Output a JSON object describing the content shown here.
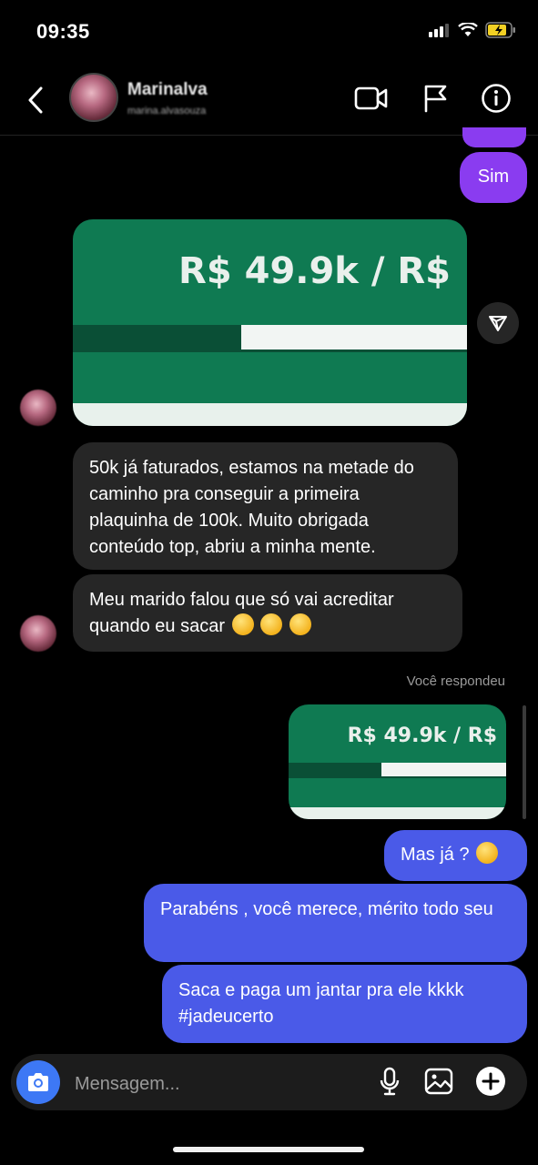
{
  "status_bar": {
    "time": "09:35"
  },
  "header": {
    "name": "Marinalva",
    "handle": "marina.alvasouza"
  },
  "messages": {
    "sent_1": "Sim",
    "card_1": {
      "text": "R$ 49.9k / R$",
      "progress": 0.42
    },
    "recv_1": "50k já faturados, estamos na metade do caminho pra conseguir a primeira plaquinha de 100k. Muito obrigada conteúdo top, abriu a minha mente.",
    "recv_2": "Meu marido falou que só vai acreditar quando eu sacar",
    "replied_label": "Você respondeu",
    "card_2": {
      "text": "R$ 49.9k / R$",
      "progress": 0.42
    },
    "sent_2": "Mas já ?",
    "sent_3": "Parabéns , você merece, mérito todo seu",
    "sent_4": "Saca e paga um jantar pra ele kkkk #jadeucerto"
  },
  "composer": {
    "placeholder": "Mensagem..."
  },
  "colors": {
    "purple_bubble": "#8a3cf0",
    "blue_bubble": "#4a5ae8",
    "received_bubble": "#262626",
    "card_green": "#0f7a52",
    "camera_button": "#3d78f5"
  },
  "icons": [
    "back-chevron-icon",
    "video-call-icon",
    "flag-icon",
    "info-icon",
    "share-icon",
    "camera-icon",
    "microphone-icon",
    "gallery-icon",
    "plus-icon",
    "signal-icon",
    "wifi-icon",
    "battery-icon"
  ]
}
